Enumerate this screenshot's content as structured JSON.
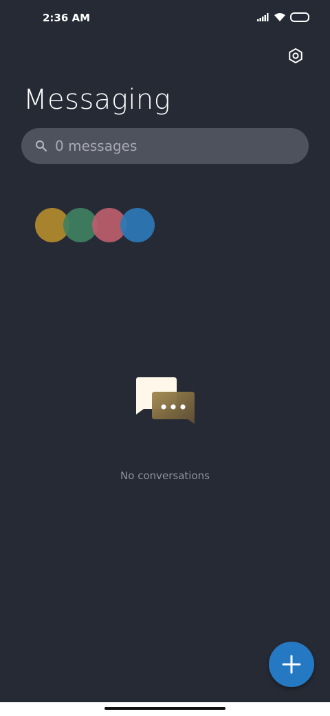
{
  "status_bar": {
    "time": "2:36 AM"
  },
  "header": {
    "title": "Messaging",
    "settings_icon": "settings-hexagon-icon"
  },
  "search": {
    "placeholder": "0 messages",
    "value": ""
  },
  "avatars": [
    {
      "color": "#b38b2c"
    },
    {
      "color": "#3f8060"
    },
    {
      "color": "#bc5e6c"
    },
    {
      "color": "#2d7ab7"
    }
  ],
  "empty_state": {
    "icon": "chat-bubbles-icon",
    "text": "No conversations"
  },
  "fab": {
    "icon": "plus-icon",
    "color": "#2479c2"
  }
}
